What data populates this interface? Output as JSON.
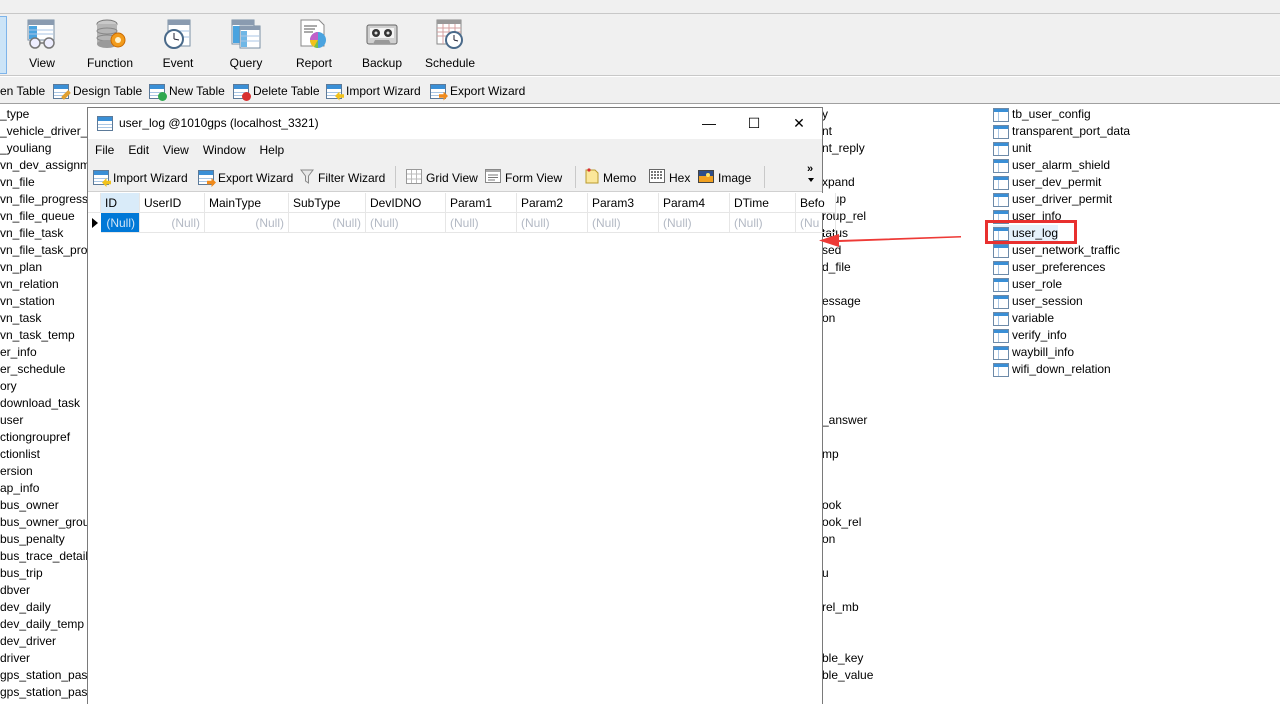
{
  "ribbon": {
    "buttons": [
      {
        "label": "View",
        "icon": "view-icon"
      },
      {
        "label": "Function",
        "icon": "function-icon"
      },
      {
        "label": "Event",
        "icon": "event-icon"
      },
      {
        "label": "Query",
        "icon": "query-icon"
      },
      {
        "label": "Report",
        "icon": "report-icon"
      },
      {
        "label": "Backup",
        "icon": "backup-icon"
      },
      {
        "label": "Schedule",
        "icon": "schedule-icon"
      }
    ]
  },
  "object_toolbar": {
    "buttons": [
      {
        "label": "en Table",
        "icon": "open-table-icon"
      },
      {
        "label": "Design Table",
        "icon": "design-table-icon"
      },
      {
        "label": "New Table",
        "icon": "new-table-icon"
      },
      {
        "label": "Delete Table",
        "icon": "delete-table-icon"
      },
      {
        "label": "Import Wizard",
        "icon": "import-wizard-icon"
      },
      {
        "label": "Export Wizard",
        "icon": "export-wizard-icon"
      }
    ]
  },
  "object_list": {
    "left_column": [
      "_type",
      "_vehicle_driver_re",
      "_youliang",
      "vn_dev_assignme",
      "vn_file",
      "vn_file_progress_r",
      "vn_file_queue",
      "vn_file_task",
      "vn_file_task_progr",
      "vn_plan",
      "vn_relation",
      "vn_station",
      "vn_task",
      "vn_task_temp",
      "er_info",
      "er_schedule",
      "ory",
      "download_task",
      "user",
      "ctiongroupref",
      "ctionlist",
      "ersion",
      "ap_info",
      "bus_owner",
      "bus_owner_grou",
      "bus_penalty",
      "bus_trace_detail",
      "bus_trip",
      "dbver",
      "dev_daily",
      "dev_daily_temp",
      "dev_driver",
      "driver",
      "gps_station_pass",
      "gps_station_pass"
    ],
    "middle_column": [
      {
        "row": 0,
        "text": "y"
      },
      {
        "row": 1,
        "text": "nt"
      },
      {
        "row": 2,
        "text": "nt_reply"
      },
      {
        "row": 4,
        "text": "xpand"
      },
      {
        "row": 5,
        "text": "roup"
      },
      {
        "row": 6,
        "text": "roup_rel"
      },
      {
        "row": 7,
        "text": "tatus"
      },
      {
        "row": 8,
        "text": "sed"
      },
      {
        "row": 9,
        "text": "d_file"
      },
      {
        "row": 11,
        "text": "essage"
      },
      {
        "row": 12,
        "text": "on"
      },
      {
        "row": 18,
        "text": "_answer"
      },
      {
        "row": 20,
        "text": "mp"
      },
      {
        "row": 23,
        "text": "ook"
      },
      {
        "row": 24,
        "text": "ook_rel"
      },
      {
        "row": 25,
        "text": "on"
      },
      {
        "row": 27,
        "text": "u"
      },
      {
        "row": 29,
        "text": "rel_mb"
      },
      {
        "row": 32,
        "text": "ble_key"
      },
      {
        "row": 33,
        "text": "ble_value"
      }
    ],
    "right_column": [
      "tb_user_config",
      "transparent_port_data",
      "unit",
      "user_alarm_shield",
      "user_dev_permit",
      "user_driver_permit",
      "user_info",
      "user_log",
      "user_network_traffic",
      "user_preferences",
      "user_role",
      "user_session",
      "variable",
      "verify_info",
      "waybill_info",
      "wifi_down_relation"
    ],
    "selected": "user_log"
  },
  "annotation": {
    "highlight_target": "user_log",
    "color": "#e8302f"
  },
  "table_window": {
    "title": "user_log @1010gps (localhost_3321)",
    "controls": {
      "minimize": "—",
      "maximize": "☐",
      "close": "✕"
    },
    "menu": [
      "File",
      "Edit",
      "View",
      "Window",
      "Help"
    ],
    "toolbar": [
      {
        "label": "Import Wizard",
        "icon": "import-wizard-icon"
      },
      {
        "label": "Export Wizard",
        "icon": "export-wizard-icon"
      },
      {
        "label": "Filter Wizard",
        "icon": "filter-icon"
      },
      {
        "label": "Grid View",
        "icon": "grid-view-icon"
      },
      {
        "label": "Form View",
        "icon": "form-view-icon"
      },
      {
        "label": "Memo",
        "icon": "memo-icon"
      },
      {
        "label": "Hex",
        "icon": "hex-icon"
      },
      {
        "label": "Image",
        "icon": "image-icon"
      }
    ],
    "overflow": "»",
    "columns": [
      "ID",
      "UserID",
      "MainType",
      "SubType",
      "DevIDNO",
      "Param1",
      "Param2",
      "Param3",
      "Param4",
      "DTime",
      "Befo"
    ],
    "rows": [
      [
        "(Null)",
        "(Null)",
        "(Null)",
        "(Null)",
        "(Null)",
        "(Null)",
        "(Null)",
        "(Null)",
        "(Null)",
        "(Null)",
        "(Nu"
      ]
    ]
  },
  "colors": {
    "selection": "#0078d7",
    "header_active": "#d9ebf9",
    "null_text": "#b3b9c4",
    "chrome": "#f0f0f0"
  }
}
